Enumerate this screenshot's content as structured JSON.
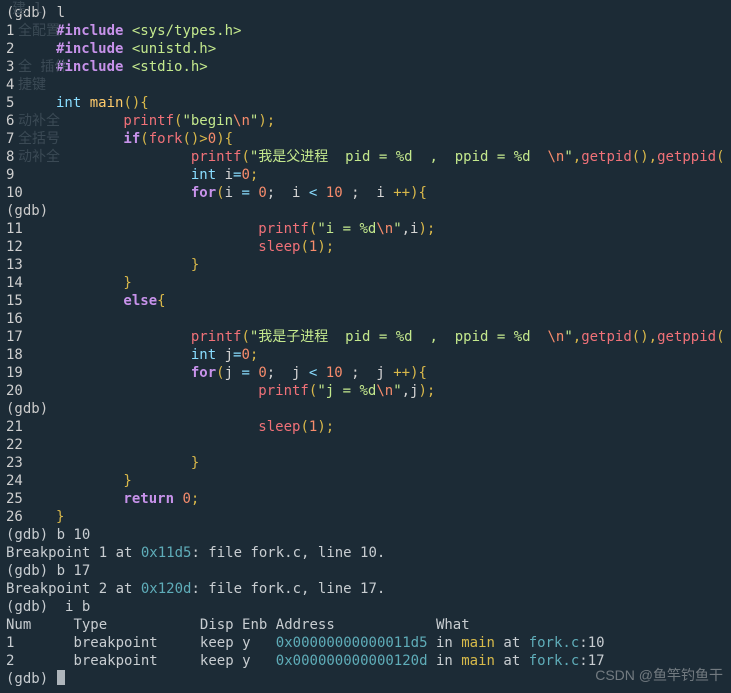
{
  "gdb": {
    "prompt_l": "(gdb) l",
    "prompt_paging": "(gdb)",
    "cmd_b10": "(gdb) b 10",
    "bp1_out": "Breakpoint 1 at ",
    "bp1_addr": "0x11d5",
    "bp1_tail": ": file ",
    "bp1_file": "fork.c",
    "bp1_end": ", line 10.",
    "cmd_b17": "(gdb) b 17",
    "bp2_out": "Breakpoint 2 at ",
    "bp2_addr": "0x120d",
    "bp2_tail": ": file ",
    "bp2_file": "fork.c",
    "bp2_end": ", line 17.",
    "cmd_ib": "(gdb)  i b",
    "hdr_num": "Num",
    "hdr_type": "Type",
    "hdr_disp": "Disp",
    "hdr_enb": "Enb",
    "hdr_addr": "Address",
    "hdr_what": "What",
    "row1_num": "1",
    "row1_type": "breakpoint",
    "row1_disp": "keep",
    "row1_enb": "y",
    "row1_addr": "0x00000000000011d5",
    "row1_in": "in",
    "row1_fn": "main",
    "row1_at": "at",
    "row1_file": "fork.c",
    "row1_ln": ":10",
    "row2_num": "2",
    "row2_type": "breakpoint",
    "row2_disp": "keep",
    "row2_enb": "y",
    "row2_addr": "0x000000000000120d",
    "row2_in": "in",
    "row2_fn": "main",
    "row2_at": "at",
    "row2_file": "fork.c",
    "row2_ln": ":17",
    "prompt_end": "(gdb) "
  },
  "hints": {
    "h1": "全配置",
    "h2": "全 插件",
    "h3": "捷键",
    "h4": "动补全",
    "h5": "全括号",
    "h6": "动补全",
    "h05": "建 l"
  },
  "src": {
    "l1": "#include",
    "h1": " <sys/types.h>",
    "l2": "#include",
    "h2": " <unistd.h>",
    "l3": "#include",
    "h3": " <stdio.h>",
    "l4": "",
    "l5a": "int",
    "l5b": " main",
    "l5c": "(){",
    "l6a": "        printf",
    "l6b": "(",
    "l6c": "\"begin",
    "l6d": "\\n",
    "l6e": "\"",
    "l6f": ");",
    "l7a": "        if",
    "l7b": "(",
    "l7c": "fork",
    "l7d": "()>",
    "l7e": "0",
    "l7f": "){",
    "l8a": "                printf",
    "l8b": "(",
    "l8c": "\"我是父进程  pid = %d  ,  ppid = %d  ",
    "l8d": "\\n",
    "l8e": "\"",
    "l8f": ",",
    "l8g": "getpid",
    "l8h": "(),",
    "l8i": "getppid",
    "l8j": "(",
    "l9a": "                int",
    "l9b": " i",
    "l9c": "=",
    "l9d": "0",
    "l9e": ";",
    "l10a": "                for",
    "l10b": "(",
    "l10c": "i ",
    "l10d": "=",
    "l10e": " 0",
    "l10f": ";  i ",
    "l10g": "<",
    "l10h": " 10",
    "l10i": " ;  i ",
    "l10j": "++){",
    "l11a": "                        printf",
    "l11b": "(",
    "l11c": "\"i = %d",
    "l11d": "\\n",
    "l11e": "\"",
    "l11f": ",i",
    "l11g": ");",
    "l12a": "                        sleep",
    "l12b": "(",
    "l12c": "1",
    "l12d": ");",
    "l13": "                }",
    "l14": "        }",
    "l15a": "        else",
    "l15b": "{",
    "l16": "",
    "l17a": "                printf",
    "l17b": "(",
    "l17c": "\"我是子进程  pid = %d  ,  ppid = %d  ",
    "l17d": "\\n",
    "l17e": "\"",
    "l17f": ",",
    "l17g": "getpid",
    "l17h": "(),",
    "l17i": "getppid",
    "l17j": "(",
    "l18a": "                int",
    "l18b": " j",
    "l18c": "=",
    "l18d": "0",
    "l18e": ";",
    "l19a": "                for",
    "l19b": "(",
    "l19c": "j ",
    "l19d": "=",
    "l19e": " 0",
    "l19f": ";  j ",
    "l19g": "<",
    "l19h": " 10",
    "l19i": " ;  j ",
    "l19j": "++){",
    "l20a": "                        printf",
    "l20b": "(",
    "l20c": "\"j = %d",
    "l20d": "\\n",
    "l20e": "\"",
    "l20f": ",j",
    "l20g": ");",
    "l21a": "                        sleep",
    "l21b": "(",
    "l21c": "1",
    "l21d": ");",
    "l22": "",
    "l23": "                }",
    "l24": "        }",
    "l25a": "        return",
    "l25b": " 0",
    "l25c": ";",
    "l26": "}"
  },
  "watermark": "CSDN @鱼竿钓鱼干"
}
